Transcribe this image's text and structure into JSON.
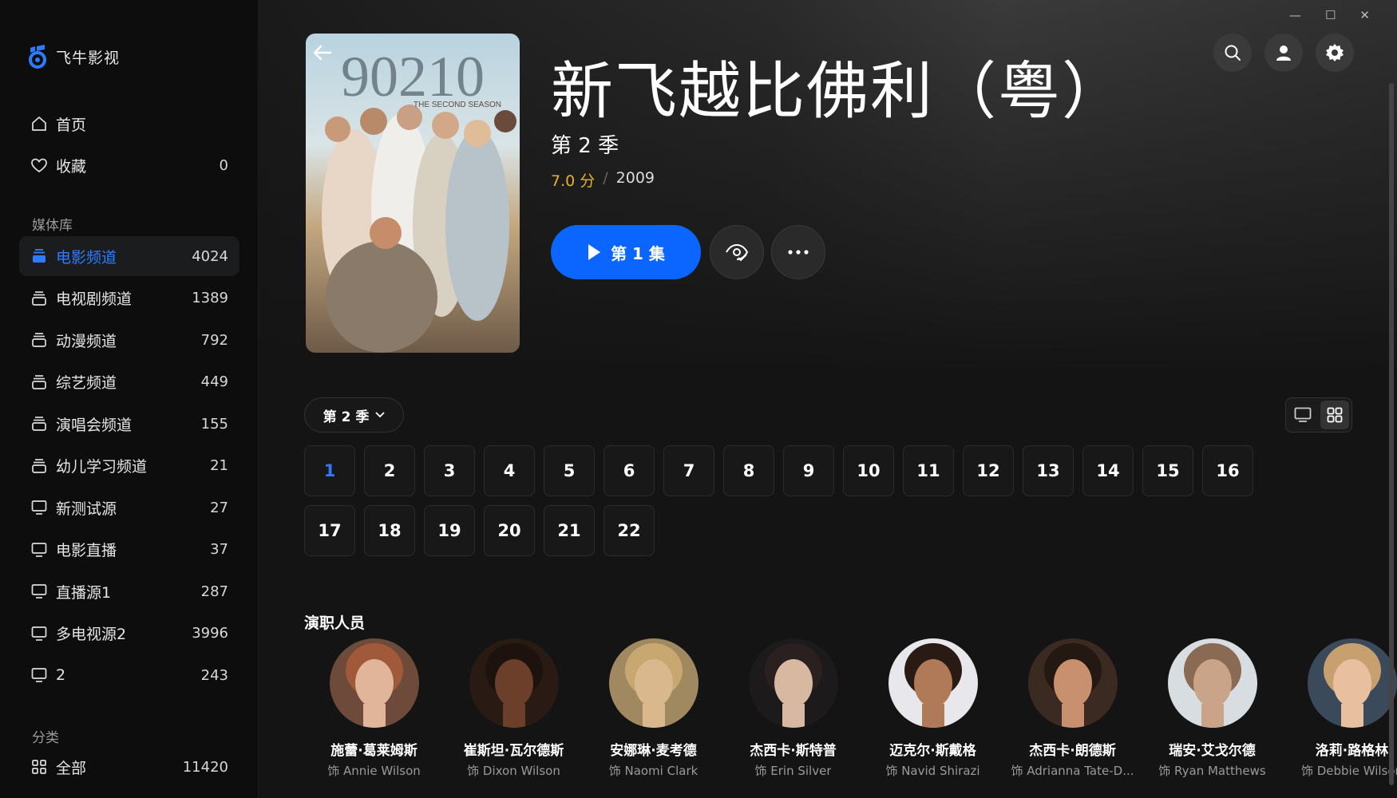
{
  "app": {
    "name": "飞牛影视"
  },
  "sidebar": {
    "nav": [
      {
        "label": "首页",
        "icon": "home-icon",
        "count": ""
      },
      {
        "label": "收藏",
        "icon": "heart-icon",
        "count": "0"
      }
    ],
    "library_label": "媒体库",
    "library": [
      {
        "label": "电影频道",
        "icon": "stack-icon",
        "count": "4024",
        "active": true
      },
      {
        "label": "电视剧频道",
        "icon": "stack-icon",
        "count": "1389"
      },
      {
        "label": "动漫频道",
        "icon": "stack-icon",
        "count": "792"
      },
      {
        "label": "综艺频道",
        "icon": "stack-icon",
        "count": "449"
      },
      {
        "label": "演唱会频道",
        "icon": "stack-icon",
        "count": "155"
      },
      {
        "label": "幼儿学习频道",
        "icon": "stack-icon",
        "count": "21"
      },
      {
        "label": "新测试源",
        "icon": "monitor-icon",
        "count": "27"
      },
      {
        "label": "电影直播",
        "icon": "monitor-icon",
        "count": "37"
      },
      {
        "label": "直播源1",
        "icon": "monitor-icon",
        "count": "287"
      },
      {
        "label": "多电视源2",
        "icon": "monitor-icon",
        "count": "3996"
      },
      {
        "label": "2",
        "icon": "monitor-icon",
        "count": "243"
      }
    ],
    "category_label": "分类",
    "category": [
      {
        "label": "全部",
        "icon": "grid-icon",
        "count": "11420"
      }
    ]
  },
  "show": {
    "title": "新飞越比佛利（粤）",
    "season_title": "第 2 季",
    "rating": "7.0 分",
    "separator": "/",
    "year": "2009",
    "poster_title": "90210",
    "poster_subtitle": "THE SECOND SEASON",
    "play_label": "第 1 集"
  },
  "season_selector": {
    "label": "第 2 季"
  },
  "episodes": [
    "1",
    "2",
    "3",
    "4",
    "5",
    "6",
    "7",
    "8",
    "9",
    "10",
    "11",
    "12",
    "13",
    "14",
    "15",
    "16",
    "17",
    "18",
    "19",
    "20",
    "21",
    "22"
  ],
  "current_episode": "1",
  "cast_title": "演职人员",
  "cast": [
    {
      "name": "施蕾·葛莱姆斯",
      "role": "饰 Annie Wilson"
    },
    {
      "name": "崔斯坦·瓦尔德斯",
      "role": "饰 Dixon Wilson"
    },
    {
      "name": "安娜琳·麦考德",
      "role": "饰 Naomi Clark"
    },
    {
      "name": "杰西卡·斯特普",
      "role": "饰 Erin Silver"
    },
    {
      "name": "迈克尔·斯戴格",
      "role": "饰 Navid Shirazi"
    },
    {
      "name": "杰西卡·朗德斯",
      "role": "饰 Adrianna Tate-D..."
    },
    {
      "name": "瑞安·艾戈尔德",
      "role": "饰 Ryan Matthews"
    },
    {
      "name": "洛莉·路格林",
      "role": "饰 Debbie Wilson"
    }
  ],
  "colors": {
    "accent": "#0a66ff",
    "active_text": "#2f7bff",
    "rating": "#e6b422"
  }
}
